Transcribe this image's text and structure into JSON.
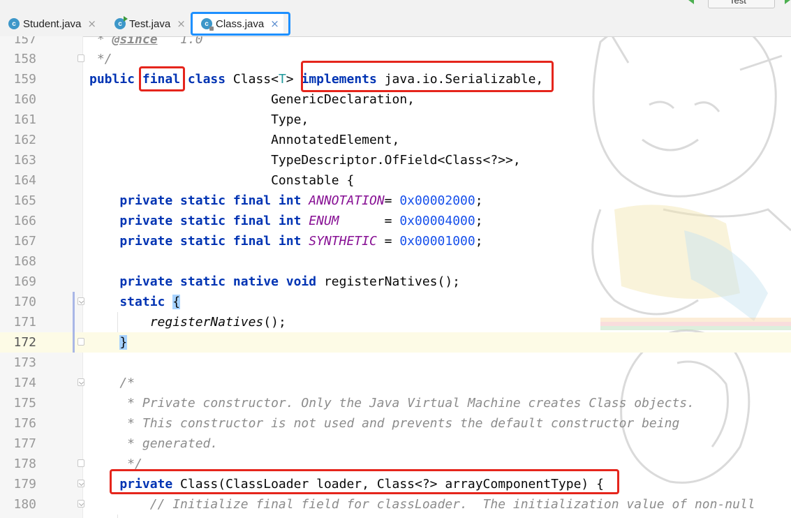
{
  "tabs": [
    {
      "label": "Student.java",
      "close": "×"
    },
    {
      "label": "Test.java",
      "close": "×"
    },
    {
      "label": "Class.java",
      "close": "×"
    }
  ],
  "top_widget": {
    "label": "Test"
  },
  "lines": [
    {
      "num": "157"
    },
    {
      "num": "158"
    },
    {
      "num": "159"
    },
    {
      "num": "160"
    },
    {
      "num": "161"
    },
    {
      "num": "162"
    },
    {
      "num": "163"
    },
    {
      "num": "164"
    },
    {
      "num": "165"
    },
    {
      "num": "166"
    },
    {
      "num": "167"
    },
    {
      "num": "168"
    },
    {
      "num": "169"
    },
    {
      "num": "170"
    },
    {
      "num": "171"
    },
    {
      "num": "172"
    },
    {
      "num": "173"
    },
    {
      "num": "174"
    },
    {
      "num": "175"
    },
    {
      "num": "176"
    },
    {
      "num": "177"
    },
    {
      "num": "178"
    },
    {
      "num": "179"
    },
    {
      "num": "180"
    }
  ],
  "code": {
    "l157": {
      "star": " * ",
      "tag": "@since",
      "rest": "   1.0"
    },
    "l158": {
      "text": " */"
    },
    "l159": {
      "kw1": "public",
      "kw2": "final",
      "kw3": "class",
      "name": " Class<",
      "tp": "T",
      "gt": "> ",
      "kw4": "implements",
      "rest": " java.io.Serializable,"
    },
    "l160": {
      "text": "                        GenericDeclaration,"
    },
    "l161": {
      "text": "                        Type,"
    },
    "l162": {
      "text": "                        AnnotatedElement,"
    },
    "l163": {
      "text": "                        TypeDescriptor.OfField<Class<?>>,"
    },
    "l164": {
      "text": "                        Constable {"
    },
    "l165": {
      "mods": "    private static final int ",
      "const": "ANNOTATION",
      "eq": "= ",
      "num": "0x00002000",
      "end": ";"
    },
    "l166": {
      "mods": "    private static final int ",
      "const": "ENUM",
      "eq": "      = ",
      "num": "0x00004000",
      "end": ";"
    },
    "l167": {
      "mods": "    private static final int ",
      "const": "SYNTHETIC",
      "eq": " = ",
      "num": "0x00001000",
      "end": ";"
    },
    "l169": {
      "mods": "    private static native void",
      "rest": " registerNatives();"
    },
    "l170": {
      "kw": "    static",
      "sp": " ",
      "brace": "{"
    },
    "l171": {
      "indent": "        ",
      "call": "registerNatives",
      "rest": "();"
    },
    "l172": {
      "indent": "    ",
      "brace": "}"
    },
    "l174": {
      "text": "    /*"
    },
    "l175": {
      "text": "     * Private constructor. Only the Java Virtual Machine creates Class objects."
    },
    "l176": {
      "text": "     * This constructor is not used and prevents the default constructor being"
    },
    "l177": {
      "text": "     * generated."
    },
    "l178": {
      "text": "     */"
    },
    "l179": {
      "kw": "    private",
      "rest": " Class(ClassLoader loader, Class<?> arrayComponentType) {"
    },
    "l180": {
      "text": "        // Initialize final field for classLoader.  The initialization value of non-null"
    }
  },
  "colors": {
    "keyword": "#0033b3",
    "comment": "#8c8c8c",
    "constant": "#871094",
    "number": "#1750eb",
    "type_param": "#20999d",
    "red_highlight": "#e5251c",
    "tab_highlight": "#1e90ff"
  }
}
